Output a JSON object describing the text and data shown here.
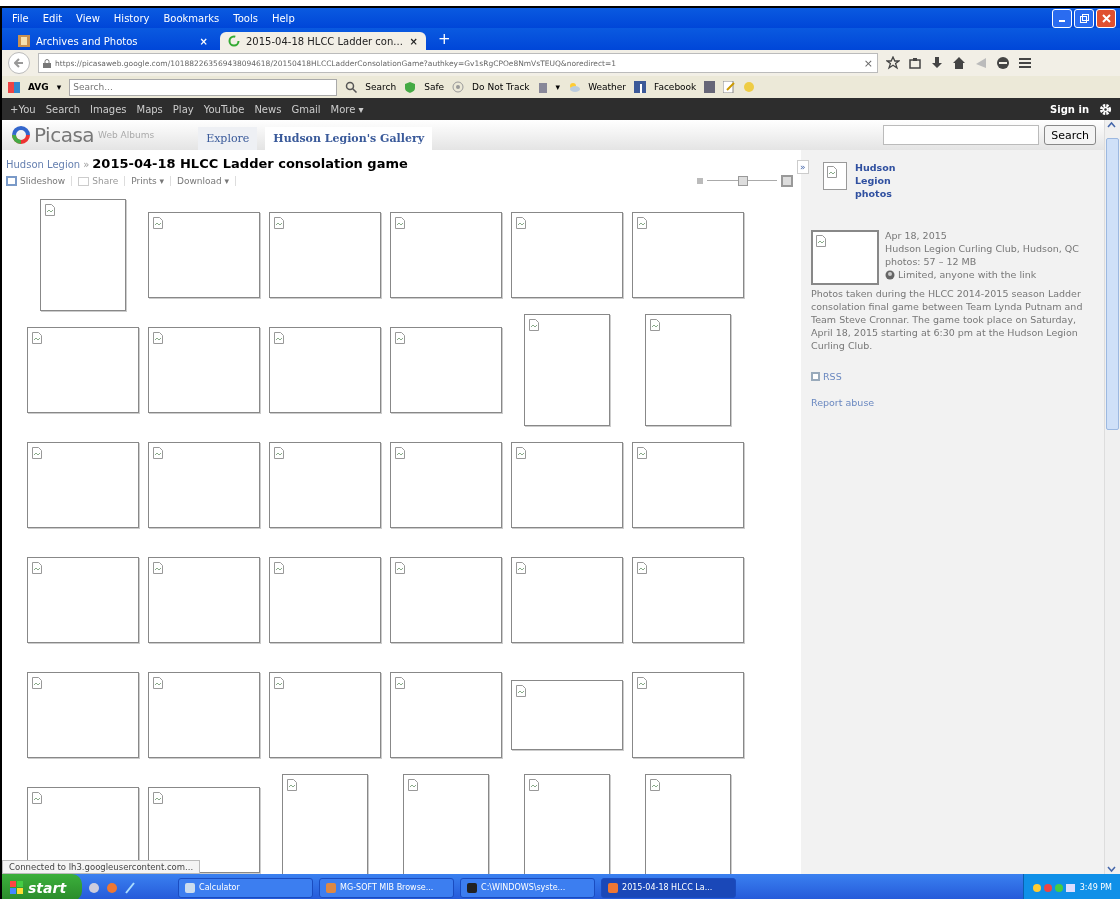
{
  "menu_bar": [
    "File",
    "Edit",
    "View",
    "History",
    "Bookmarks",
    "Tools",
    "Help"
  ],
  "tabs": [
    {
      "label": "Archives and Photos",
      "close": "×",
      "selected": false
    },
    {
      "label": "2015-04-18 HLCC Ladder con...",
      "close": "×",
      "selected": true
    }
  ],
  "new_tab": "+",
  "address_bar": {
    "url": "https://picasaweb.google.com/101882263569438094618/20150418HLCCLadderConsolationGame?authkey=Gv1sRgCPOe8NmVsTEUQ&noredirect=1",
    "clear": "×"
  },
  "toolbar": {
    "brand": "AVG",
    "brand_caret": "▾",
    "search_placeholder": "Search...",
    "items": [
      "Search",
      "Safe",
      "Do Not Track",
      "▾",
      "Weather",
      "Facebook"
    ]
  },
  "google_bar": {
    "links": [
      "+You",
      "Search",
      "Images",
      "Maps",
      "Play",
      "YouTube",
      "News",
      "Gmail",
      "More ▾"
    ],
    "sign_in": "Sign in"
  },
  "picasa": {
    "logo": "Picasa",
    "logo_sub": "Web Albums",
    "tabs": [
      {
        "label": "Explore",
        "selected": false
      },
      {
        "label": "Hudson Legion's Gallery",
        "selected": true
      }
    ],
    "search_button": "Search"
  },
  "album": {
    "breadcrumb": "Hudson Legion",
    "separator": "»",
    "title": "2015-04-18 HLCC Ladder consolation game",
    "actions": [
      {
        "label": "Slideshow",
        "disabled": false
      },
      {
        "label": "Share",
        "disabled": true
      },
      {
        "label": "Prints ▾",
        "disabled": false
      },
      {
        "label": "Download ▾",
        "disabled": false
      }
    ],
    "size_slider": {
      "level": 0.5
    },
    "rows": [
      {
        "photos": [
          {
            "kind": "portrait"
          },
          {
            "kind": "landscape"
          },
          {
            "kind": "landscape"
          },
          {
            "kind": "landscape"
          },
          {
            "kind": "landscape"
          },
          {
            "kind": "landscape"
          }
        ]
      },
      {
        "photos": [
          {
            "kind": "landscape"
          },
          {
            "kind": "landscape"
          },
          {
            "kind": "landscape"
          },
          {
            "kind": "landscape"
          },
          {
            "kind": "portrait"
          },
          {
            "kind": "portrait"
          }
        ]
      },
      {
        "photos": [
          {
            "kind": "landscape"
          },
          {
            "kind": "landscape"
          },
          {
            "kind": "landscape"
          },
          {
            "kind": "landscape"
          },
          {
            "kind": "landscape"
          },
          {
            "kind": "landscape"
          }
        ]
      },
      {
        "photos": [
          {
            "kind": "landscape"
          },
          {
            "kind": "landscape"
          },
          {
            "kind": "landscape"
          },
          {
            "kind": "landscape"
          },
          {
            "kind": "landscape"
          },
          {
            "kind": "landscape"
          }
        ]
      },
      {
        "photos": [
          {
            "kind": "landscape"
          },
          {
            "kind": "landscape"
          },
          {
            "kind": "landscape"
          },
          {
            "kind": "landscape"
          },
          {
            "kind": "wide"
          },
          {
            "kind": "landscape"
          }
        ]
      },
      {
        "photos": [
          {
            "kind": "landscape"
          },
          {
            "kind": "landscape"
          },
          {
            "kind": "portrait"
          },
          {
            "kind": "portrait"
          },
          {
            "kind": "portrait"
          },
          {
            "kind": "portrait"
          }
        ]
      }
    ]
  },
  "sidebar": {
    "collapse": "»",
    "owner": "Hudson Legion photos",
    "date": "Apr 18, 2015",
    "location": "Hudson Legion Curling Club, Hudson, QC",
    "stats": "photos: 57 – 12 MB",
    "visibility": "Limited, anyone with the link",
    "description": "Photos taken during the HLCC 2014-2015 season Ladder consolation final game between Team Lynda Putnam and Team Steve Cronnar. The game took place on Saturday, April 18, 2015 starting at 6:30 pm at the Hudson Legion Curling Club.",
    "rss": "RSS",
    "report": "Report abuse"
  },
  "status_bar": "Connected to lh3.googleusercontent.com...",
  "taskbar": {
    "start": "start",
    "tasks": [
      {
        "label": "Calculator",
        "selected": false
      },
      {
        "label": "MG-SOFT MIB Browse...",
        "selected": false
      },
      {
        "label": "C:\\WINDOWS\\syste...",
        "selected": false
      },
      {
        "label": "2015-04-18 HLCC La...",
        "selected": true
      }
    ],
    "clock": "3:49 PM"
  }
}
